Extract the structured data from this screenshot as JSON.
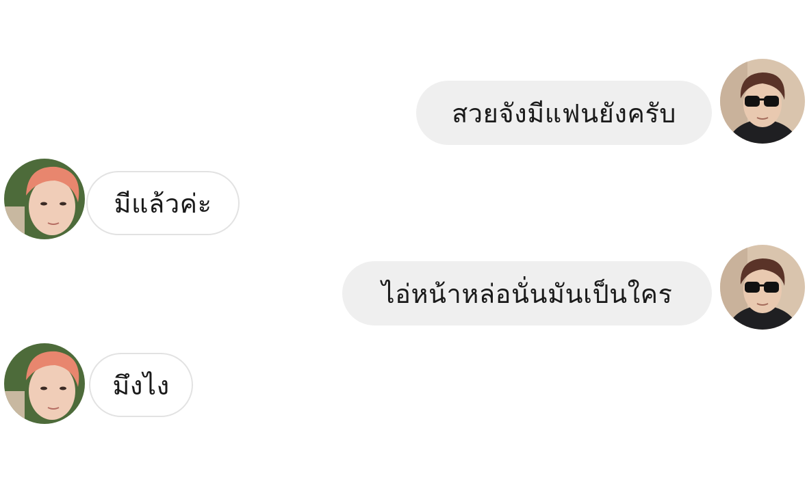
{
  "conversation": {
    "messages": [
      {
        "side": "sent",
        "text": "สวยจังมีแฟนยังครับ",
        "avatar": "user-avatar-sunglasses"
      },
      {
        "side": "received",
        "text": "มีแล้วค่ะ",
        "avatar": "contact-avatar-pink-hair"
      },
      {
        "side": "sent",
        "text": "ไอ่หน้าหล่อนั่นมันเป็นใคร",
        "avatar": "user-avatar-sunglasses"
      },
      {
        "side": "received",
        "text": "มึงไง",
        "avatar": "contact-avatar-pink-hair"
      }
    ]
  },
  "colors": {
    "sent_bubble": "#efefef",
    "received_border": "#e2e2e2",
    "text": "#1a1a1a",
    "background": "#ffffff"
  }
}
